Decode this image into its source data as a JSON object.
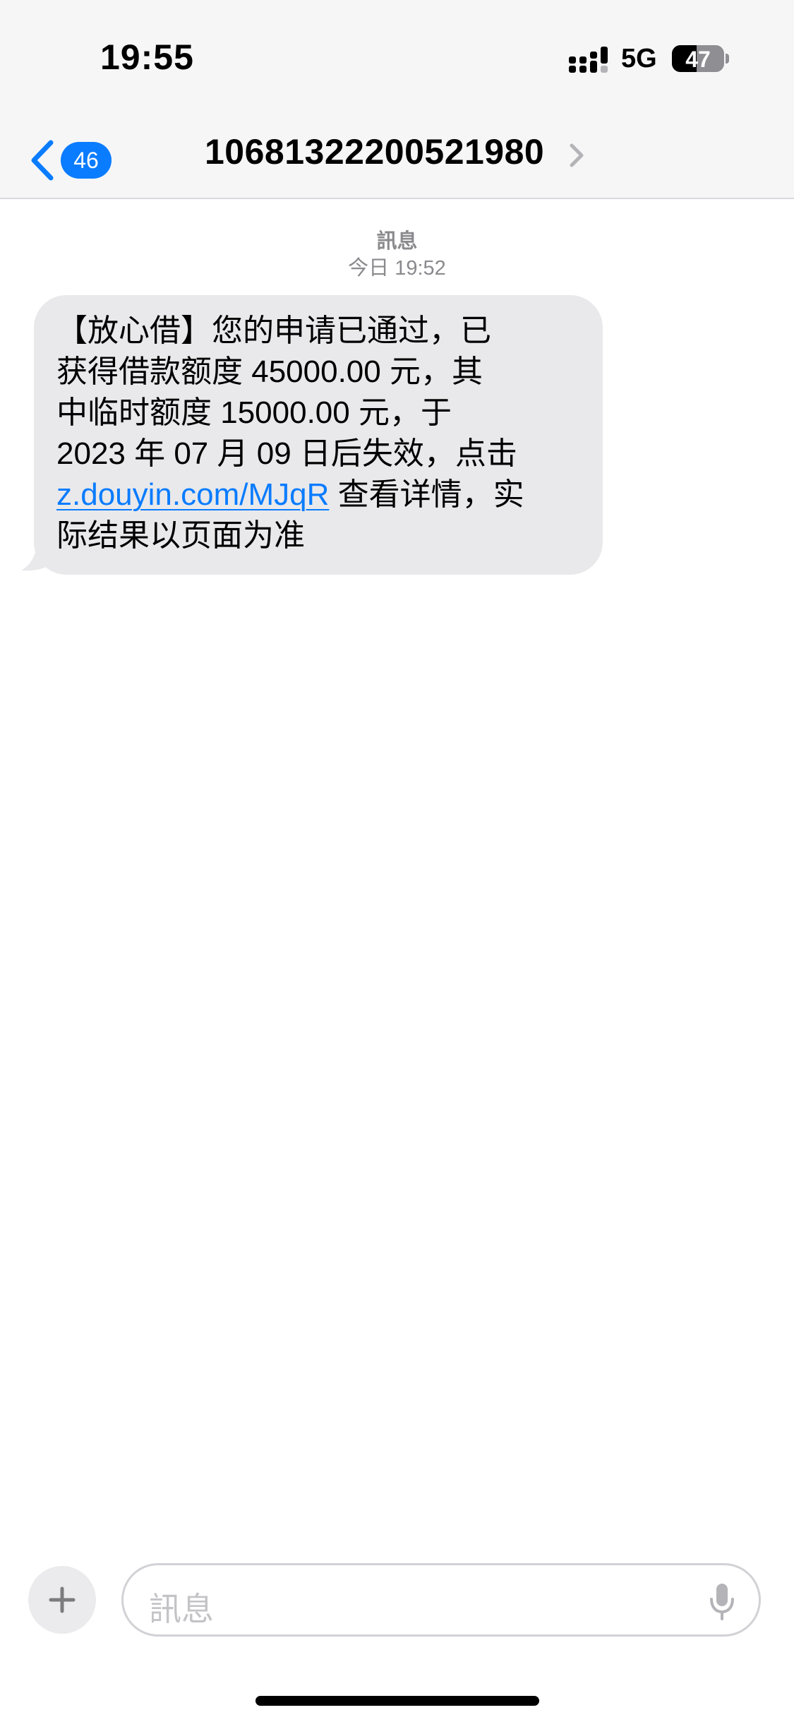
{
  "status_bar": {
    "time": "19:55",
    "network": "5G",
    "battery_level": "47",
    "battery_fraction": 0.47
  },
  "nav": {
    "back_badge": "46",
    "contact": "10681322200521980"
  },
  "conversation": {
    "service": "訊息",
    "timestamp": "今日 19:52"
  },
  "message": {
    "lines": [
      "【放心借】您的申请已通过，已",
      "获得借款额度 45000.00 元，其",
      "中临时额度 15000.00 元，于",
      " 2023 年 07 月 09 日后失效，点击"
    ],
    "link": "z.douyin.com/MJqR",
    "after_link": " 查看详情，实",
    "last_line": "际结果以页面为准"
  },
  "compose": {
    "placeholder": "訊息"
  },
  "colors": {
    "accent": "#0a7cff",
    "bubble": "#e9e9eb",
    "secondary_text": "#8a8a8e"
  },
  "icons": [
    "signal-icon",
    "battery-icon",
    "back-chevron-icon",
    "chevron-right-icon",
    "plus-icon",
    "microphone-icon"
  ]
}
